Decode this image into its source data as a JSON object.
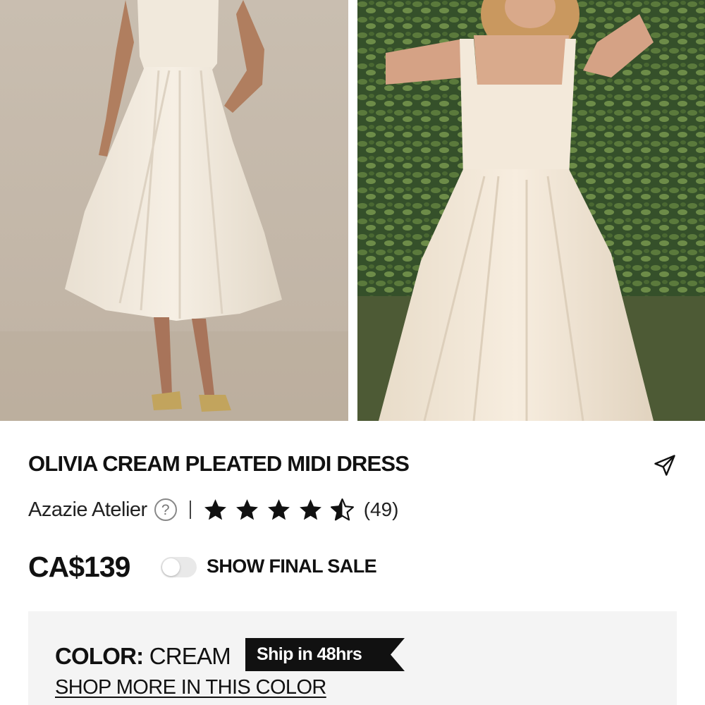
{
  "product": {
    "title": "OLIVIA CREAM PLEATED MIDI DRESS",
    "brand": "Azazie Atelier",
    "rating": 4.5,
    "rating_max": 5,
    "review_count": "(49)",
    "price": "CA$139",
    "final_sale_toggle": {
      "label": "SHOW FINAL SALE",
      "on": false
    }
  },
  "color_panel": {
    "color_key": "COLOR:",
    "color_value": "CREAM",
    "ship_badge": "Ship in 48hrs",
    "shop_more_link": "SHOP MORE IN THIS COLOR"
  },
  "images": [
    {
      "icon": "product-photo-front",
      "alt": ""
    },
    {
      "icon": "product-photo-model-outdoor",
      "alt": ""
    }
  ],
  "icons": {
    "share": "share-icon",
    "help": "help-icon",
    "star": "star-icon"
  },
  "colors": {
    "text": "#111111",
    "panel_bg": "#f4f4f4",
    "badge_bg": "#111111",
    "toggle_off": "#e9e9e9"
  }
}
